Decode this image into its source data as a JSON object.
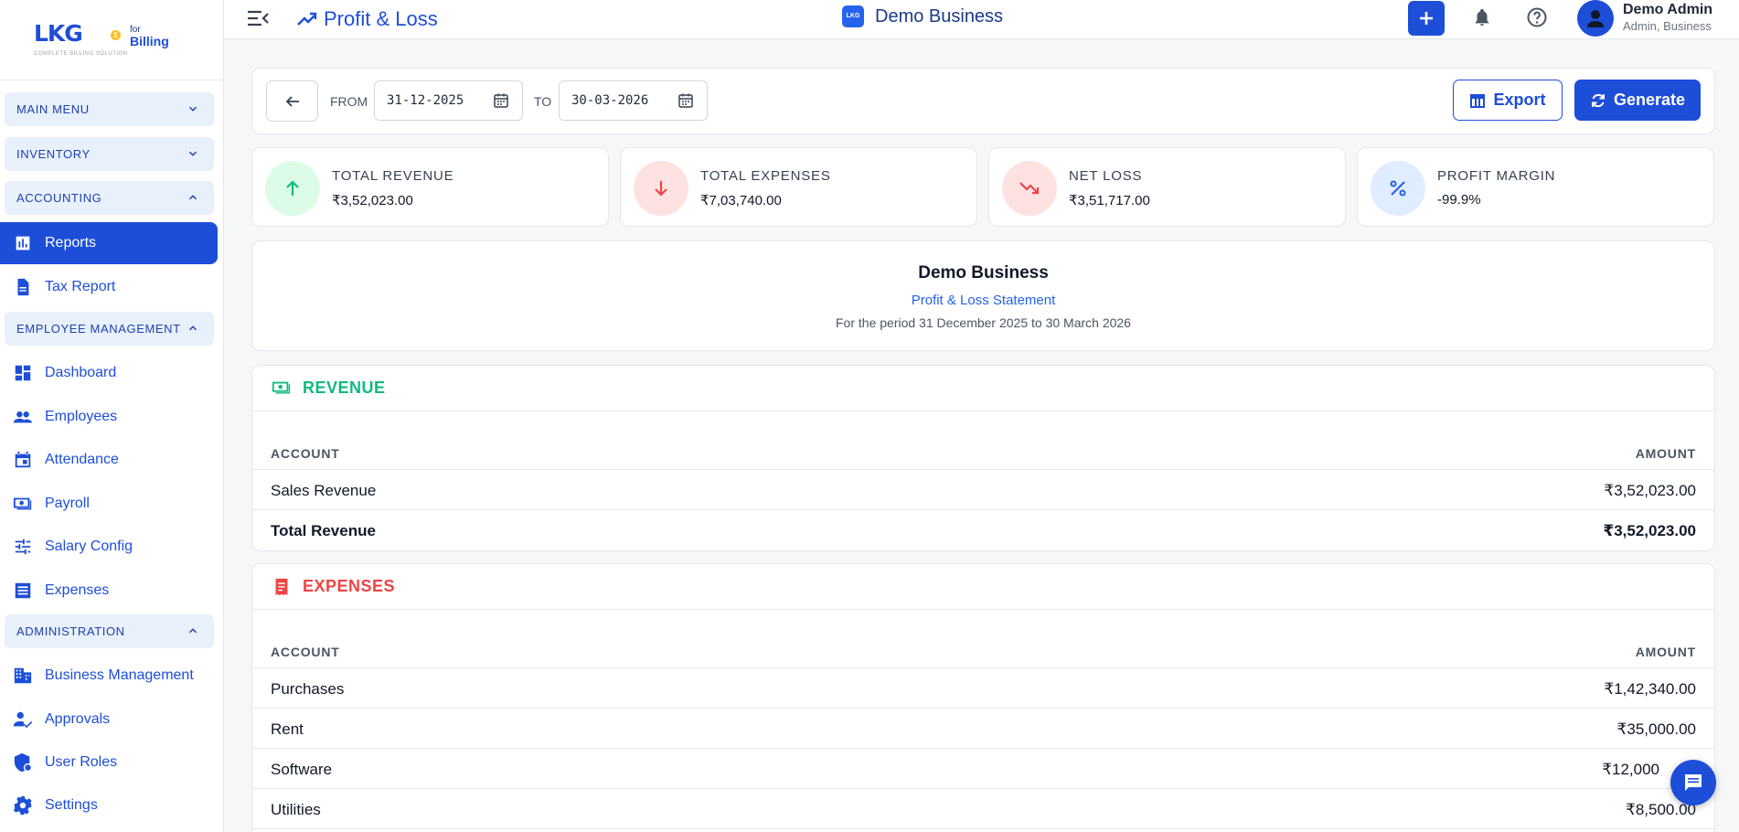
{
  "brand": {
    "logo_text": "LKG",
    "for_text": "for",
    "product": "Billing",
    "tagline": "COMPLETE BILLING SOLUTION"
  },
  "sidebar": {
    "sections": [
      {
        "label": "MAIN MENU",
        "expanded": false
      },
      {
        "label": "INVENTORY",
        "expanded": false
      },
      {
        "label": "ACCOUNTING",
        "expanded": true
      },
      {
        "label": "EMPLOYEE MANAGEMENT",
        "expanded": true
      },
      {
        "label": "ADMINISTRATION",
        "expanded": true
      }
    ],
    "accounting_items": [
      {
        "label": "Reports",
        "icon": "bar-chart-icon",
        "active": true
      },
      {
        "label": "Tax Report",
        "icon": "document-icon",
        "active": false
      }
    ],
    "employee_items": [
      {
        "label": "Dashboard",
        "icon": "dashboard-icon"
      },
      {
        "label": "Employees",
        "icon": "people-icon"
      },
      {
        "label": "Attendance",
        "icon": "calendar-icon"
      },
      {
        "label": "Payroll",
        "icon": "payroll-icon"
      },
      {
        "label": "Salary Config",
        "icon": "sliders-icon"
      },
      {
        "label": "Expenses",
        "icon": "list-icon"
      }
    ],
    "admin_items": [
      {
        "label": "Business Management",
        "icon": "building-icon"
      },
      {
        "label": "Approvals",
        "icon": "approval-icon"
      },
      {
        "label": "User Roles",
        "icon": "shield-icon"
      },
      {
        "label": "Settings",
        "icon": "gear-icon"
      }
    ]
  },
  "header": {
    "title": "Profit & Loss",
    "business_badge": "LKG",
    "business_name": "Demo Business",
    "user_name": "Demo Admin",
    "user_role": "Admin, Business"
  },
  "filters": {
    "from_label": "FROM",
    "from_date": "31-12-2025",
    "to_label": "TO",
    "to_date": "30-03-2026",
    "export_label": "Export",
    "generate_label": "Generate"
  },
  "stats": [
    {
      "label": "TOTAL REVENUE",
      "value": "₹3,52,023.00",
      "color": "#10b981",
      "bg": "#dcfce7",
      "icon": "arrow-up-icon"
    },
    {
      "label": "TOTAL EXPENSES",
      "value": "₹7,03,740.00",
      "color": "#ef4444",
      "bg": "#fee2e2",
      "icon": "arrow-down-icon"
    },
    {
      "label": "NET LOSS",
      "value": "₹3,51,717.00",
      "color": "#ef4444",
      "bg": "#fee2e2",
      "icon": "trending-down-icon"
    },
    {
      "label": "PROFIT MARGIN",
      "value": "-99.9%",
      "color": "#2563eb",
      "bg": "#e0ecff",
      "icon": "percent-icon"
    }
  ],
  "statement": {
    "business": "Demo Business",
    "subtitle": "Profit & Loss Statement",
    "period": "For the period 31 December 2025 to 30 March 2026"
  },
  "revenue": {
    "title": "REVENUE",
    "color": "#10b981",
    "col_account": "ACCOUNT",
    "col_amount": "AMOUNT",
    "rows": [
      {
        "account": "Sales Revenue",
        "amount": "₹3,52,023.00"
      }
    ],
    "total_label": "Total Revenue",
    "total_amount": "₹3,52,023.00"
  },
  "expenses": {
    "title": "EXPENSES",
    "color": "#ef4444",
    "col_account": "ACCOUNT",
    "col_amount": "AMOUNT",
    "rows": [
      {
        "account": "Purchases",
        "amount": "₹1,42,340.00"
      },
      {
        "account": "Rent",
        "amount": "₹35,000.00"
      },
      {
        "account": "Software",
        "amount": "₹12,000"
      },
      {
        "account": "Utilities",
        "amount": "₹8,500.00"
      }
    ]
  }
}
